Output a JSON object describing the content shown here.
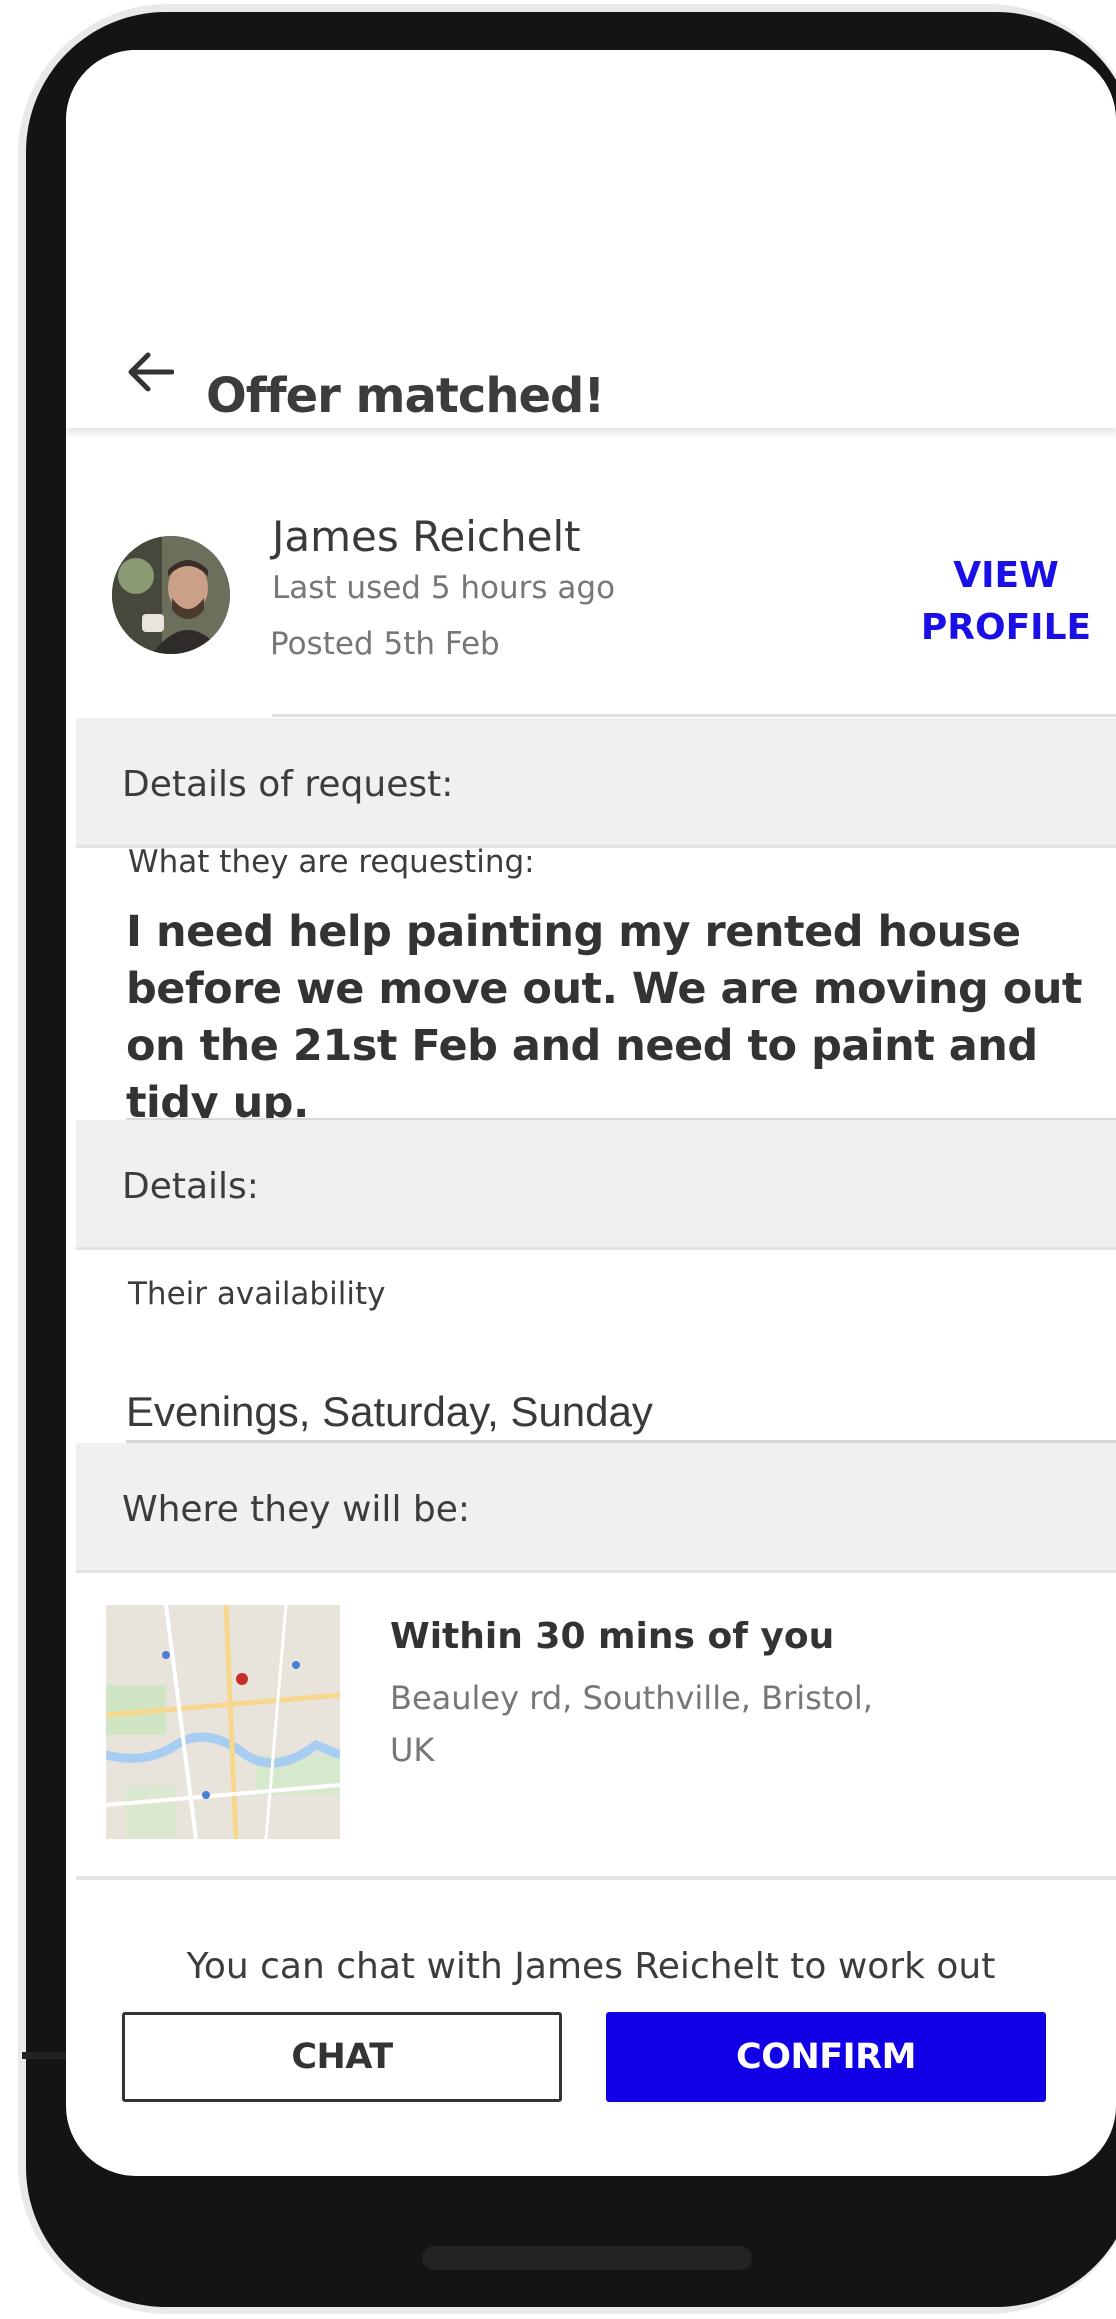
{
  "header": {
    "title": "Offer matched!",
    "back_icon": "arrow-left-icon"
  },
  "profile": {
    "name": "James Reichelt",
    "last_used": "Last used 5 hours ago",
    "posted": "Posted 5th Feb",
    "view_profile_line1": "VIEW",
    "view_profile_line2": "PROFILE",
    "accent_color": "#1a10e6"
  },
  "request": {
    "section_title": "Details of request:",
    "label": "What they are requesting:",
    "text": "I need help painting my rented house before we move out. We are moving out on the 21st Feb and need to paint and tidy up."
  },
  "details": {
    "section_title": "Details:",
    "availability_label": "Their availability",
    "availability_value": "Evenings, Saturday, Sunday"
  },
  "location": {
    "section_title": "Where they will be:",
    "title": "Within 30 mins of you",
    "address": "Beauley rd, Southville, Bristol, UK"
  },
  "footer": {
    "chat_info": "You can chat with James Reichelt to work out",
    "chat_label": "CHAT",
    "confirm_label": "CONFIRM",
    "confirm_color": "#1100e6"
  }
}
